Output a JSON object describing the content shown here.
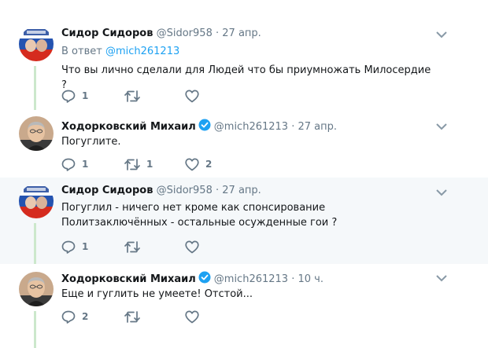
{
  "tweets": [
    {
      "name": "Сидор Сидоров",
      "handle": "@Sidor958",
      "separator": "·",
      "time": "27 апр.",
      "reply_prefix": "В ответ",
      "reply_mention": "@mich261213",
      "text": "Что вы лично сделали для Людей что бы приумножать Милосердие ?",
      "reply_count": "1",
      "retweet_count": "",
      "like_count": "",
      "avatar_icon": "tricolor-flag-avatar"
    },
    {
      "name": "Ходорковский Михаил",
      "handle": "@mich261213",
      "separator": "·",
      "time": "27 апр.",
      "verified": true,
      "text": "Погуглите.",
      "reply_count": "1",
      "retweet_count": "1",
      "like_count": "2",
      "avatar_icon": "portrait-avatar"
    },
    {
      "name": "Сидор Сидоров",
      "handle": "@Sidor958",
      "separator": "·",
      "time": "27 апр.",
      "text": "Погуглил - ничего нет кроме как спонсирование Политзаключённых - остальные осужденные гои ?",
      "reply_count": "1",
      "retweet_count": "",
      "like_count": "",
      "avatar_icon": "tricolor-flag-avatar"
    },
    {
      "name": "Ходорковский Михаил",
      "handle": "@mich261213",
      "separator": "·",
      "time": "10 ч.",
      "verified": true,
      "text": "Еще и гуглить не умеете! Отстой...",
      "reply_count": "2",
      "retweet_count": "",
      "like_count": "",
      "avatar_icon": "portrait-avatar"
    }
  ],
  "colors": {
    "accent": "#1da1f2",
    "muted": "#657786",
    "thread_line": "#cce8cc",
    "highlight_bg": "#f5f8fa"
  }
}
